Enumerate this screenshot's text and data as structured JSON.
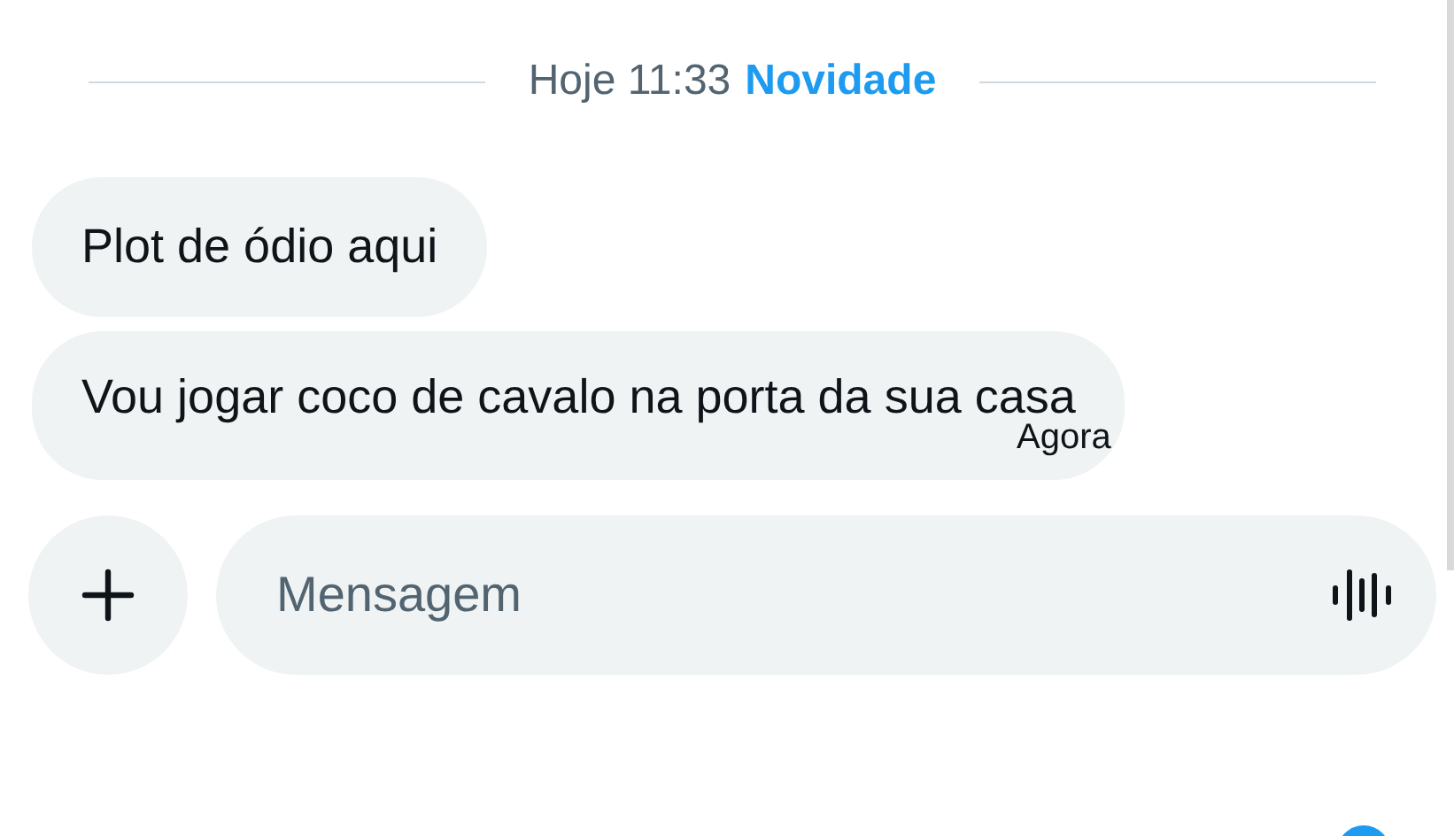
{
  "divider": {
    "date": "Hoje 11:33",
    "tag": "Novidade"
  },
  "messages": [
    {
      "text": "Plot de ódio aqui"
    },
    {
      "text": "Vou jogar coco de cavalo na porta da sua casa",
      "time": "Agora"
    }
  ],
  "composer": {
    "placeholder": "Mensagem"
  }
}
